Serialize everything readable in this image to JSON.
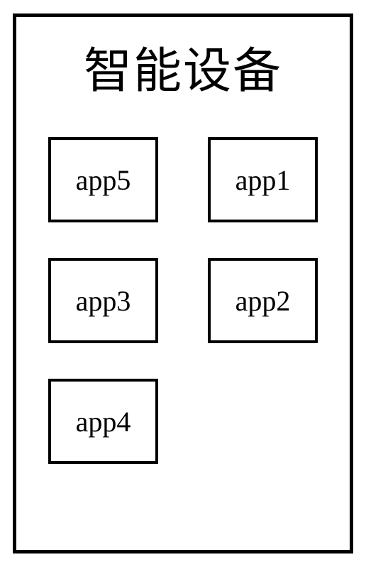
{
  "device": {
    "title": "智能设备"
  },
  "apps": {
    "row1_left": "app5",
    "row1_right": "app1",
    "row2_left": "app3",
    "row2_right": "app2",
    "row3_left": "app4"
  }
}
